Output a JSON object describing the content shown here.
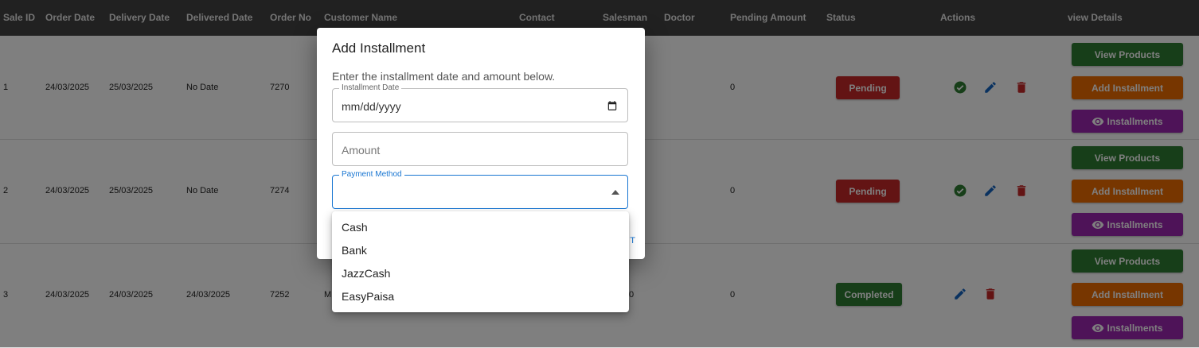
{
  "table": {
    "headers": {
      "sale_id": "Sale ID",
      "order_date": "Order Date",
      "delivery_date": "Delivery Date",
      "delivered_date": "Delivered Date",
      "order_no": "Order No",
      "customer_name": "Customer Name",
      "contact": "Contact",
      "salesman": "Salesman",
      "doctor": "Doctor",
      "pending_amount": "Pending Amount",
      "status": "Status",
      "actions": "Actions",
      "view_details": "view Details"
    },
    "rows": [
      {
        "sale_id": "1",
        "order_date": "24/03/2025",
        "delivery_date": "25/03/2025",
        "delivered_date": "No Date",
        "order_no": "7270",
        "customer_partial": "",
        "contact_partial": "",
        "pending_amount": "0",
        "status": "Pending"
      },
      {
        "sale_id": "2",
        "order_date": "24/03/2025",
        "delivery_date": "25/03/2025",
        "delivered_date": "No Date",
        "order_no": "7274",
        "customer_partial": "",
        "contact_partial": "",
        "pending_amount": "0",
        "status": "Pending"
      },
      {
        "sale_id": "3",
        "order_date": "24/03/2025",
        "delivery_date": "24/03/2025",
        "delivered_date": "24/03/2025",
        "order_no": "7252",
        "customer_partial": "M",
        "contact_partial": "0",
        "pending_amount": "0",
        "status": "Completed"
      }
    ],
    "buttons": {
      "view_products": "View Products",
      "add_installment": "Add Installment",
      "installments": "Installments"
    }
  },
  "dialog": {
    "title": "Add Installment",
    "description": "Enter the installment date and amount below.",
    "date_label": "Installment Date",
    "date_value": "mm/dd/yyyy",
    "amount_placeholder": "Amount",
    "payment_label": "Payment Method",
    "hint_text": "T"
  },
  "payment_menu": {
    "options": [
      "Cash",
      "Bank",
      "JazzCash",
      "EasyPaisa"
    ]
  },
  "colors": {
    "header_bg": "#434343",
    "pending": "#c62828",
    "completed": "#2e7d32",
    "view_products": "#2e7d32",
    "add_installment": "#ef6c00",
    "installments": "#9c27b0",
    "approve_icon": "#2e7d32",
    "edit_icon": "#1565c0",
    "delete_icon": "#c62828",
    "focus": "#1976d2"
  },
  "icons": [
    "check-circle-icon",
    "pencil-icon",
    "trash-icon",
    "eye-icon",
    "calendar-icon",
    "caret-up-icon"
  ]
}
